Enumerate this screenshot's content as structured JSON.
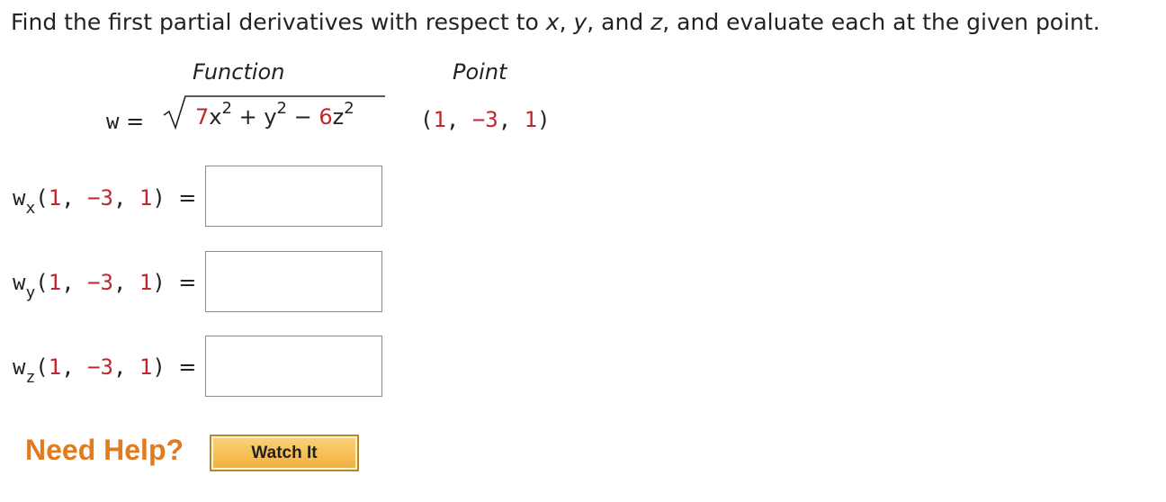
{
  "prompt": {
    "before_x": "Find the first partial derivatives with respect to ",
    "var_x": "x",
    "sep1": ", ",
    "var_y": "y",
    "sep2": ", and ",
    "var_z": "z",
    "after": ", and evaluate each at the given point."
  },
  "table": {
    "function_header": "Function",
    "point_header": "Point"
  },
  "function": {
    "lhs": "w",
    "equals": "=",
    "coef1": "7",
    "var1": "x",
    "exp1": "2",
    "op1": "+",
    "var2": "y",
    "exp2": "2",
    "op2": "−",
    "coef3": "6",
    "var3": "z",
    "exp3": "2"
  },
  "point": {
    "open": "(",
    "x": "1",
    "comma1": ", ",
    "y": "−3",
    "comma2": ", ",
    "z": "1",
    "close": ")"
  },
  "answers": [
    {
      "func": "w",
      "sub": "x",
      "open": "(",
      "x": "1",
      "comma1": ", ",
      "y": "−3",
      "comma2": ", ",
      "z": "1",
      "close": ")",
      "equals": "=",
      "value": ""
    },
    {
      "func": "w",
      "sub": "y",
      "open": "(",
      "x": "1",
      "comma1": ", ",
      "y": "−3",
      "comma2": ", ",
      "z": "1",
      "close": ")",
      "equals": "=",
      "value": ""
    },
    {
      "func": "w",
      "sub": "z",
      "open": "(",
      "x": "1",
      "comma1": ", ",
      "y": "−3",
      "comma2": ", ",
      "z": "1",
      "close": ")",
      "equals": "=",
      "value": ""
    }
  ],
  "help": {
    "label": "Need Help?",
    "watch_button": "Watch It"
  },
  "colors": {
    "number_red": "#c0262d",
    "help_orange": "#e07b20",
    "button_gold": "#f2ae3b"
  }
}
